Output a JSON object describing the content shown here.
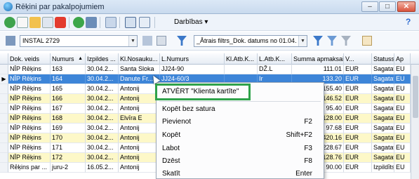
{
  "window": {
    "title": "Rēķini par pakalpojumiem",
    "minimize": "–",
    "maximize": "□",
    "close": "✕"
  },
  "toolbar": {
    "actions_label": "Darbības",
    "actions_arrow": "▾",
    "help": "?"
  },
  "filterbar": {
    "company_value": "INSTAL 2729",
    "filter_value": "_Ātrais filtrs_Dok. datums no 01.04."
  },
  "grid": {
    "columns": [
      "Dok. veids",
      "Numurs",
      "Izpildes ...",
      "Kl.Nosauku...",
      "L.Numurs",
      "Kl.Atb.K...",
      "L.Atb.K...",
      "Summa apmaksai",
      "V...",
      "Statuss",
      "Ap"
    ],
    "sort_arrow": "▲",
    "rows": [
      [
        "NĪP Rēķins",
        "163",
        "30.04.2...",
        "Santa Sloka",
        "JJ24-90",
        "",
        "DŽ.L",
        "111.01",
        "EUR",
        "Sagatave",
        "EU"
      ],
      [
        "NĪP Rēķins",
        "164",
        "30.04.2...",
        "Danute Fr...",
        "JJ24-60/3",
        "",
        "Ir",
        "133.20",
        "EUR",
        "Sagatave",
        "EU"
      ],
      [
        "NĪP Rēķins",
        "165",
        "30.04.2...",
        "Antonij",
        "",
        "",
        "",
        "155.40",
        "EUR",
        "Sagatave",
        "EU"
      ],
      [
        "NĪP Rēķins",
        "166",
        "30.04.2...",
        "Antonij",
        "",
        "",
        "",
        "146.52",
        "EUR",
        "Sagatave",
        "EU"
      ],
      [
        "NĪP Rēķins",
        "167",
        "30.04.2...",
        "Antonij",
        "",
        "",
        "",
        "95.40",
        "EUR",
        "Sagatave",
        "EU"
      ],
      [
        "NĪP Rēķins",
        "168",
        "30.04.2...",
        "Elvīra E",
        "",
        "",
        "",
        "128.00",
        "EUR",
        "Sagatave",
        "EU"
      ],
      [
        "NĪP Rēķins",
        "169",
        "30.04.2...",
        "Antonij",
        "",
        "",
        "",
        "97.68",
        "EUR",
        "Sagatave",
        "EU"
      ],
      [
        "NĪP Rēķins",
        "170",
        "30.04.2...",
        "Antonij",
        "",
        "",
        "",
        "420.16",
        "EUR",
        "Sagatave",
        "EU"
      ],
      [
        "NĪP Rēķins",
        "171",
        "30.04.2...",
        "Antonij",
        "",
        "",
        "",
        "228.67",
        "EUR",
        "Sagatave",
        "EU"
      ],
      [
        "NĪP Rēķins",
        "172",
        "30.04.2...",
        "Antonij",
        "",
        "",
        "",
        "128.76",
        "EUR",
        "Sagatave",
        "EU"
      ],
      [
        "Rēķins par ...",
        "juru-2",
        "16.05.2...",
        "Antonij",
        "",
        "",
        "",
        "90.00",
        "EUR",
        "Izpildīts",
        "EU"
      ]
    ]
  },
  "context_menu": {
    "items": [
      {
        "label": "ATVĒRT  \"Klienta kartīte\"",
        "shortcut": ""
      },
      {
        "label": "Kopēt bez satura",
        "shortcut": ""
      },
      {
        "label": "Pievienot",
        "shortcut": "F2"
      },
      {
        "label": "Kopēt",
        "shortcut": "Shift+F2"
      },
      {
        "label": "Labot",
        "shortcut": "F3"
      },
      {
        "label": "Dzēst",
        "shortcut": "F8"
      },
      {
        "label": "Skatīt",
        "shortcut": "Enter"
      }
    ]
  },
  "colors": {
    "selected_row": "#3d85d8",
    "yellow_row": "#fdf8c8",
    "highlight_box": "#2fa24a"
  }
}
